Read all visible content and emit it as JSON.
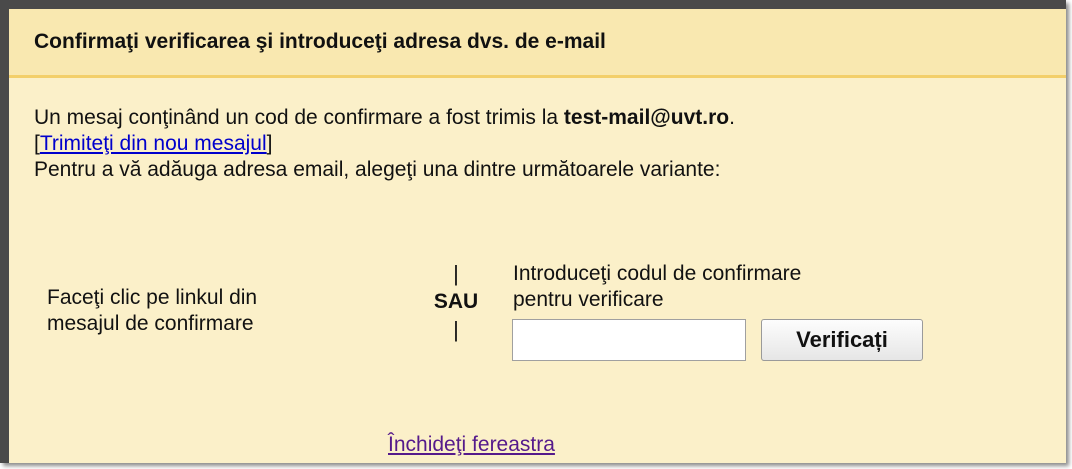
{
  "dialog": {
    "title": "Confirmaţi verificarea şi introduceţi adresa dvs. de e-mail",
    "message_prefix": "Un mesaj conţinând un cod de confirmare a fost trimis la ",
    "email": "test-mail@uvt.ro",
    "message_suffix": ".",
    "resend_bracket_open": "[",
    "resend_link": "Trimiteţi din nou mesajul",
    "resend_bracket_close": "]",
    "instructions": "Pentru a vă adăuga adresa email, alegeţi una dintre următoarele variante:",
    "option_link_line1": "Faceţi clic pe linkul din",
    "option_link_line2": "mesajul de confirmare",
    "separator_bar": "|",
    "separator_text": "SAU",
    "option_code_line1": "Introduceţi codul de confirmare",
    "option_code_line2": "pentru verificare",
    "code_input_value": "",
    "verify_button": "Verificați",
    "close_link": "Închideţi fereastra"
  },
  "colors": {
    "background": "#fbf0c9",
    "header_background": "#f9e8b0",
    "header_border": "#f3cf6a",
    "link": "#0000cc",
    "visited_link": "#551a8b"
  }
}
